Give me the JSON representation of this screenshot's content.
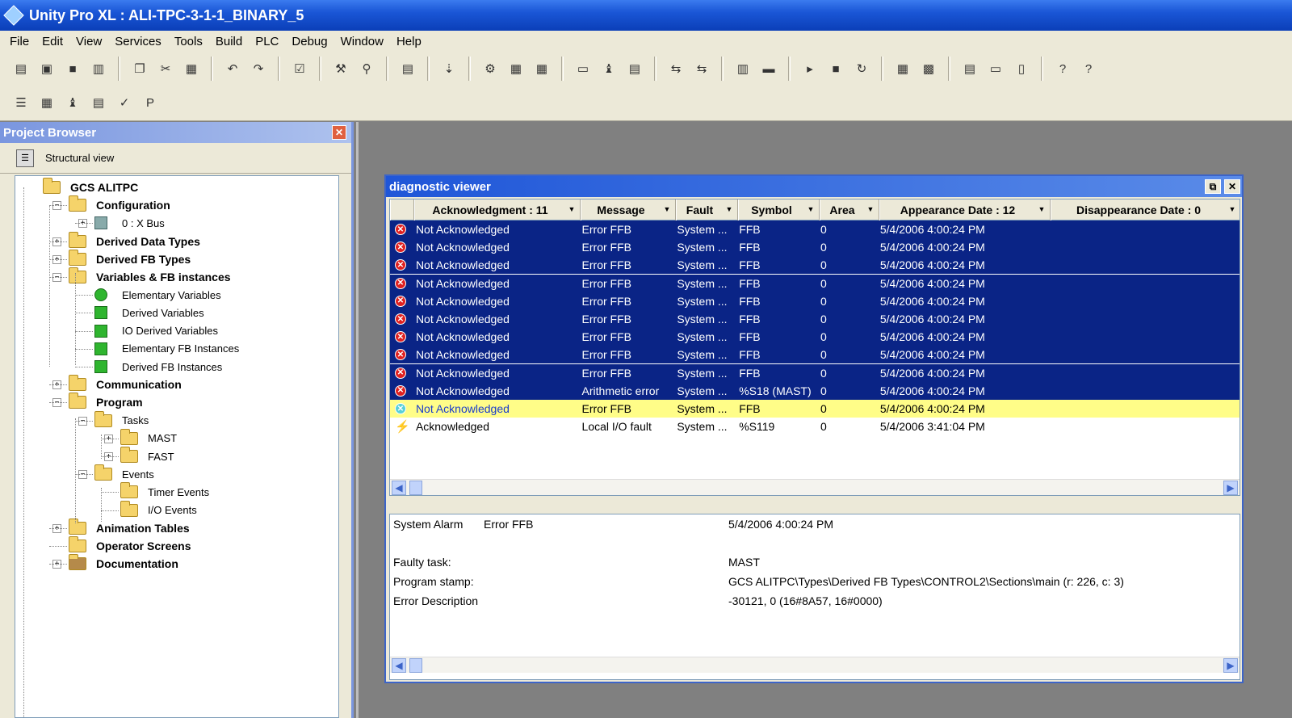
{
  "window": {
    "title": "Unity Pro XL : ALI-TPC-3-1-1_BINARY_5"
  },
  "menu": [
    "File",
    "Edit",
    "View",
    "Services",
    "Tools",
    "Build",
    "PLC",
    "Debug",
    "Window",
    "Help"
  ],
  "toolbar": {
    "row1_icons": [
      "new-icon",
      "open-icon",
      "save-icon",
      "print-icon",
      "|",
      "copy-icon",
      "cut-icon",
      "paste-icon",
      "|",
      "undo-icon",
      "redo-icon",
      "|",
      "analyze-icon",
      "|",
      "build-icon",
      "search-icon",
      "|",
      "library-icon",
      "|",
      "export-icon",
      "|",
      "transfer-icon",
      "compare-icon",
      "memory-icon",
      "|",
      "screen-icon",
      "binoculars-icon",
      "document-icon",
      "|",
      "connect-icon",
      "disconnect-icon",
      "|",
      "sim-icon",
      "laptop-icon",
      "|",
      "run-icon",
      "stop-icon",
      "init-icon",
      "|",
      "animation-icon",
      "monitor-icon",
      "|",
      "tile-icon",
      "horizontal-icon",
      "vertical-icon",
      "|",
      "help-icon",
      "context-help-icon"
    ],
    "row2_icons": [
      "structure-icon",
      "window-icon",
      "binoculars-icon",
      "table-icon",
      "ack-icon",
      "p-icon"
    ],
    "row1_glyphs": [
      "▤",
      "▣",
      "■",
      "▥",
      "|",
      "❐",
      "✂",
      "▦",
      "|",
      "↶",
      "↷",
      "|",
      "☑",
      "|",
      "⚒",
      "⚲",
      "|",
      "▤",
      "|",
      "⇣",
      "|",
      "⚙",
      "▦",
      "▦",
      "|",
      "▭",
      "♝",
      "▤",
      "|",
      "⇆",
      "⇆",
      "|",
      "▥",
      "▬",
      "|",
      "▸",
      "■",
      "↻",
      "|",
      "▦",
      "▩",
      "|",
      "▤",
      "▭",
      "▯",
      "|",
      "?",
      "?"
    ],
    "row2_glyphs": [
      "☰",
      "▦",
      "♝",
      "▤",
      "✓",
      "P"
    ]
  },
  "project_browser": {
    "title": "Project Browser",
    "view_label": "Structural view",
    "tree": [
      {
        "label": "GCS ALITPC",
        "level": 0,
        "bold": true,
        "icon": "folder",
        "expander": ""
      },
      {
        "label": "Configuration",
        "level": 1,
        "bold": true,
        "icon": "folder",
        "expander": "−"
      },
      {
        "label": "0 : X Bus",
        "level": 2,
        "bold": false,
        "icon": "bus",
        "expander": "+"
      },
      {
        "label": "Derived Data Types",
        "level": 1,
        "bold": true,
        "icon": "folder",
        "expander": "+"
      },
      {
        "label": "Derived FB Types",
        "level": 1,
        "bold": true,
        "icon": "folder",
        "expander": "+"
      },
      {
        "label": "Variables & FB instances",
        "level": 1,
        "bold": true,
        "icon": "folder",
        "expander": "−"
      },
      {
        "label": "Elementary Variables",
        "level": 2,
        "bold": false,
        "icon": "green-round",
        "expander": ""
      },
      {
        "label": "Derived Variables",
        "level": 2,
        "bold": false,
        "icon": "green",
        "expander": ""
      },
      {
        "label": "IO Derived Variables",
        "level": 2,
        "bold": false,
        "icon": "green",
        "expander": ""
      },
      {
        "label": "Elementary FB Instances",
        "level": 2,
        "bold": false,
        "icon": "green",
        "expander": ""
      },
      {
        "label": "Derived FB Instances",
        "level": 2,
        "bold": false,
        "icon": "green",
        "expander": ""
      },
      {
        "label": "Communication",
        "level": 1,
        "bold": true,
        "icon": "folder",
        "expander": "+"
      },
      {
        "label": "Program",
        "level": 1,
        "bold": true,
        "icon": "folder",
        "expander": "−"
      },
      {
        "label": "Tasks",
        "level": 2,
        "bold": false,
        "icon": "folder",
        "expander": "−"
      },
      {
        "label": "MAST",
        "level": 3,
        "bold": false,
        "icon": "folder",
        "expander": "+"
      },
      {
        "label": "FAST",
        "level": 3,
        "bold": false,
        "icon": "folder",
        "expander": "+"
      },
      {
        "label": "Events",
        "level": 2,
        "bold": false,
        "icon": "folder",
        "expander": "−"
      },
      {
        "label": "Timer Events",
        "level": 3,
        "bold": false,
        "icon": "folder",
        "expander": ""
      },
      {
        "label": "I/O Events",
        "level": 3,
        "bold": false,
        "icon": "folder",
        "expander": ""
      },
      {
        "label": "Animation Tables",
        "level": 1,
        "bold": true,
        "icon": "folder",
        "expander": "+"
      },
      {
        "label": "Operator Screens",
        "level": 1,
        "bold": true,
        "icon": "folder",
        "expander": ""
      },
      {
        "label": "Documentation",
        "level": 1,
        "bold": true,
        "icon": "doc",
        "expander": "+"
      }
    ]
  },
  "diagnostic_viewer": {
    "title": "diagnostic viewer",
    "columns": [
      "Acknowledgment : 11",
      "Message",
      "Fault",
      "Symbol",
      "Area",
      "Appearance Date : 12",
      "Disappearance Date : 0"
    ],
    "rows": [
      {
        "state": "sel",
        "icon": "err",
        "ack": "Not Acknowledged",
        "message": "Error FFB",
        "fault": "System ...",
        "symbol": "FFB",
        "area": "0",
        "appear": "5/4/2006 4:00:24 PM",
        "disappear": ""
      },
      {
        "state": "sel",
        "icon": "err",
        "ack": "Not Acknowledged",
        "message": "Error FFB",
        "fault": "System ...",
        "symbol": "FFB",
        "area": "0",
        "appear": "5/4/2006 4:00:24 PM",
        "disappear": ""
      },
      {
        "state": "sel",
        "icon": "err",
        "ack": "Not Acknowledged",
        "message": "Error FFB",
        "fault": "System ...",
        "symbol": "FFB",
        "area": "0",
        "appear": "5/4/2006 4:00:24 PM",
        "disappear": ""
      },
      {
        "state": "sel",
        "icon": "err",
        "ack": "Not Acknowledged",
        "message": "Error FFB",
        "fault": "System ...",
        "symbol": "FFB",
        "area": "0",
        "appear": "5/4/2006 4:00:24 PM",
        "disappear": ""
      },
      {
        "state": "sel",
        "icon": "err",
        "ack": "Not Acknowledged",
        "message": "Error FFB",
        "fault": "System ...",
        "symbol": "FFB",
        "area": "0",
        "appear": "5/4/2006 4:00:24 PM",
        "disappear": ""
      },
      {
        "state": "sel",
        "icon": "err",
        "ack": "Not Acknowledged",
        "message": "Error FFB",
        "fault": "System ...",
        "symbol": "FFB",
        "area": "0",
        "appear": "5/4/2006 4:00:24 PM",
        "disappear": ""
      },
      {
        "state": "sel",
        "icon": "err",
        "ack": "Not Acknowledged",
        "message": "Error FFB",
        "fault": "System ...",
        "symbol": "FFB",
        "area": "0",
        "appear": "5/4/2006 4:00:24 PM",
        "disappear": ""
      },
      {
        "state": "sel",
        "icon": "err",
        "ack": "Not Acknowledged",
        "message": "Error FFB",
        "fault": "System ...",
        "symbol": "FFB",
        "area": "0",
        "appear": "5/4/2006 4:00:24 PM",
        "disappear": ""
      },
      {
        "state": "sel",
        "icon": "err",
        "ack": "Not Acknowledged",
        "message": "Error FFB",
        "fault": "System ...",
        "symbol": "FFB",
        "area": "0",
        "appear": "5/4/2006 4:00:24 PM",
        "disappear": ""
      },
      {
        "state": "sel",
        "icon": "err",
        "ack": "Not Acknowledged",
        "message": "Arithmetic error",
        "fault": "System ...",
        "symbol": "%S18 (MAST)",
        "area": "0",
        "appear": "5/4/2006 4:00:24 PM",
        "disappear": ""
      },
      {
        "state": "cur",
        "icon": "err-cyan",
        "ack": "Not Acknowledged",
        "message": "Error FFB",
        "fault": "System ...",
        "symbol": "FFB",
        "area": "0",
        "appear": "5/4/2006 4:00:24 PM",
        "disappear": ""
      },
      {
        "state": "",
        "icon": "bolt",
        "ack": "Acknowledged",
        "message": "Local I/O fault",
        "fault": "System ...",
        "symbol": "%S119",
        "area": "0",
        "appear": "5/4/2006 3:41:04 PM",
        "disappear": ""
      }
    ],
    "detail": {
      "type": "System Alarm",
      "message": "Error FFB",
      "date": "5/4/2006 4:00:24 PM",
      "faulty_task_label": "Faulty task:",
      "faulty_task_value": "MAST",
      "program_stamp_label": "Program stamp:",
      "program_stamp_value": "GCS ALITPC\\Types\\Derived FB Types\\CONTROL2\\Sections\\main (r: 226, c: 3)",
      "error_desc_label": "Error Description",
      "error_desc_value": "-30121, 0 (16#8A57, 16#0000)"
    }
  },
  "colors": {
    "selection": "#0a2486",
    "current_row": "#fffd88",
    "title_blue": "#1a56d6",
    "panel": "#ece9d8"
  }
}
